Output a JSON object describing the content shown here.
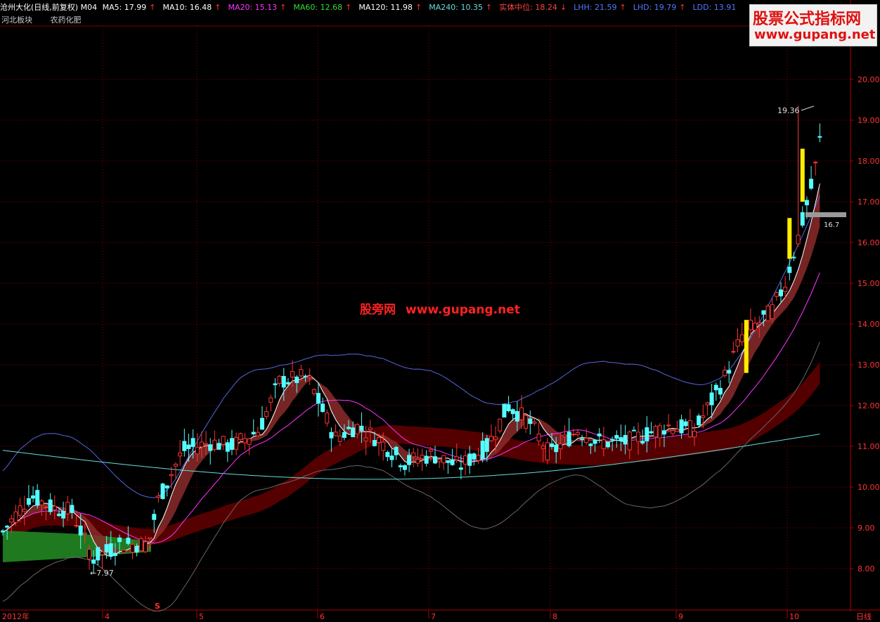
{
  "header": {
    "title": "沧州大化(日线,前复权) M04",
    "ma": [
      {
        "label": "MA5: 17.99",
        "arrow": "↑",
        "color": "#ffffff"
      },
      {
        "label": "MA10: 16.48",
        "arrow": "↑",
        "color": "#ffffff"
      },
      {
        "label": "MA20: 15.13",
        "arrow": "↑",
        "color": "#ff33ff"
      },
      {
        "label": "MA60: 12.68",
        "arrow": "↑",
        "color": "#33dd33"
      },
      {
        "label": "MA120: 11.98",
        "arrow": "↑",
        "color": "#ffffff"
      },
      {
        "label": "MA240: 10.35",
        "arrow": "↑",
        "color": "#66dddd"
      },
      {
        "label": "实体中位: 18.24",
        "arrow": "↓",
        "color": "#ff4444"
      },
      {
        "label": "LHH: 21.59",
        "arrow": "↑",
        "color": "#5577ff"
      },
      {
        "label": "LHD: 19.79",
        "arrow": "↑",
        "color": "#5577ff"
      },
      {
        "label": "LDD: 13.91",
        "arrow": "",
        "color": "#5577ff"
      }
    ],
    "board": "河北板块",
    "industry": "农药化肥"
  },
  "watermark": {
    "line1": "股票公式指标网",
    "line2": "www.gupang.net"
  },
  "center_mark": {
    "cn": "股旁网",
    "url": "www.gupang.net"
  },
  "annotations": {
    "high": "19.36",
    "low": "←7.97",
    "tag": "16.7"
  },
  "signal_marks": [
    "S"
  ],
  "chart_data": {
    "type": "candlestick",
    "title": "沧州大化(日线,前复权) M04",
    "x_ticks": [
      "2012年",
      "4",
      "5",
      "6",
      "7",
      "8",
      "9",
      "10",
      "日线"
    ],
    "y_ticks": [
      "8.00",
      "9.00",
      "10.00",
      "11.00",
      "12.00",
      "13.00",
      "14.00",
      "15.00",
      "16.00",
      "17.00",
      "18.00",
      "19.00",
      "20.00"
    ],
    "ylim": [
      7.2,
      21.7
    ],
    "grid": true,
    "key_points": {
      "low": 7.97,
      "high": 19.36,
      "last_close": 18.5
    },
    "series": [
      {
        "name": "MA5",
        "last": 17.99
      },
      {
        "name": "MA10",
        "last": 16.48
      },
      {
        "name": "MA20",
        "last": 15.13
      },
      {
        "name": "MA60",
        "last": 12.68
      },
      {
        "name": "MA120",
        "last": 11.98
      },
      {
        "name": "MA240",
        "last": 10.35
      },
      {
        "name": "实体中位",
        "last": 18.24
      },
      {
        "name": "LHH",
        "last": 21.59
      },
      {
        "name": "LHD",
        "last": 19.79
      },
      {
        "name": "LDD",
        "last": 13.91
      }
    ],
    "colors": {
      "up": "#ff3333",
      "down": "#54ffff",
      "ma5": "#ffffff",
      "ma20": "#ff33ff",
      "ma240": "#66dddd",
      "bands": "#5566dd",
      "grid": "#8b0000"
    }
  }
}
